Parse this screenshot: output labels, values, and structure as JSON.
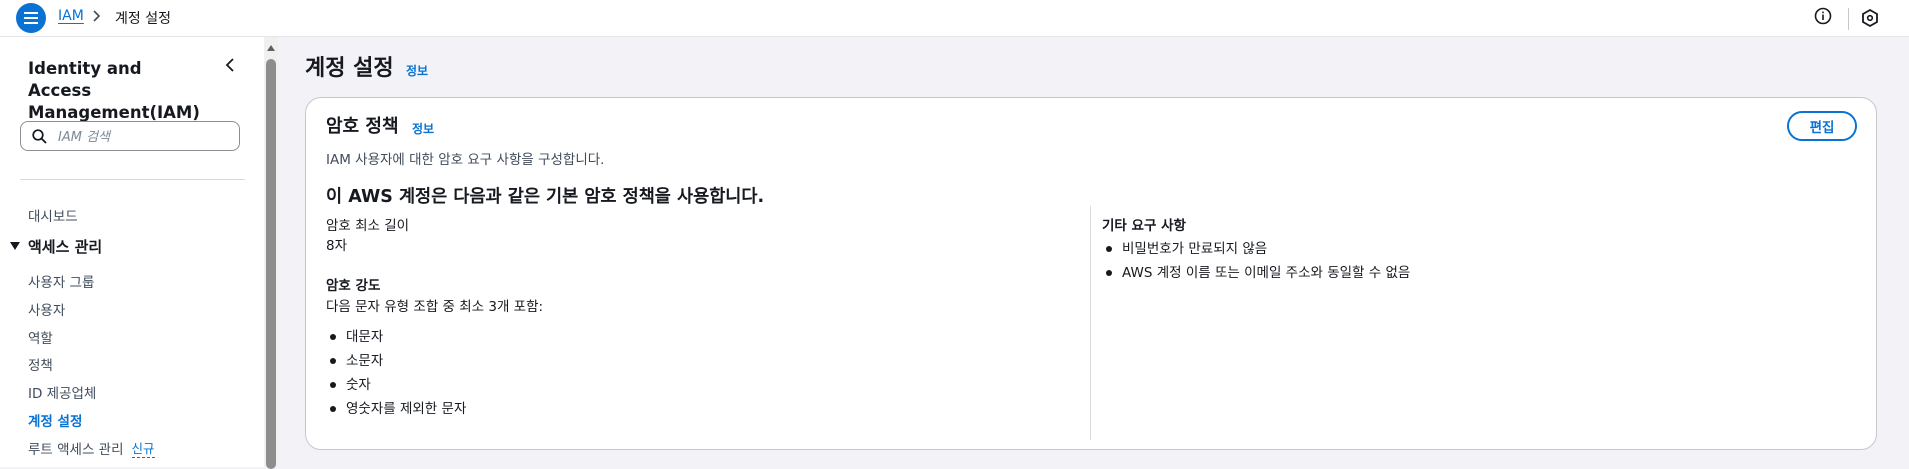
{
  "topbar": {
    "breadcrumb_root": "IAM",
    "breadcrumb_current": "계정 설정"
  },
  "sidebar": {
    "title": "Identity and Access Management(IAM)",
    "search_placeholder": "IAM 검색",
    "dashboard": "대시보드",
    "section_access": "액세스 관리",
    "items": [
      {
        "label": "사용자 그룹"
      },
      {
        "label": "사용자"
      },
      {
        "label": "역할"
      },
      {
        "label": "정책"
      },
      {
        "label": "ID 제공업체"
      },
      {
        "label": "계정 설정"
      },
      {
        "label": "루트 액세스 관리"
      }
    ],
    "new_badge": "신규"
  },
  "main": {
    "title": "계정 설정",
    "title_info": "정보"
  },
  "password_policy": {
    "title": "암호 정책",
    "info": "정보",
    "description": "IAM 사용자에 대한 암호 요구 사항을 구성합니다.",
    "edit_label": "편집",
    "heading": "이 AWS 계정은 다음과 같은 기본 암호 정책을 사용합니다.",
    "min_length_label": "암호 최소 길이",
    "min_length_value": "8자",
    "strength_label": "암호 강도",
    "strength_desc": "다음 문자 유형 조합 중 최소 3개 포함:",
    "strength_items": [
      "대문자",
      "소문자",
      "숫자",
      "영숫자를 제외한 문자"
    ],
    "other_label": "기타 요구 사항",
    "other_items": [
      "비밀번호가 만료되지 않음",
      "AWS 계정 이름 또는 이메일 주소와 동일할 수 없음"
    ]
  },
  "colors": {
    "accent": "#0972d3",
    "text": "#16191f",
    "background": "#f3f3f7"
  }
}
